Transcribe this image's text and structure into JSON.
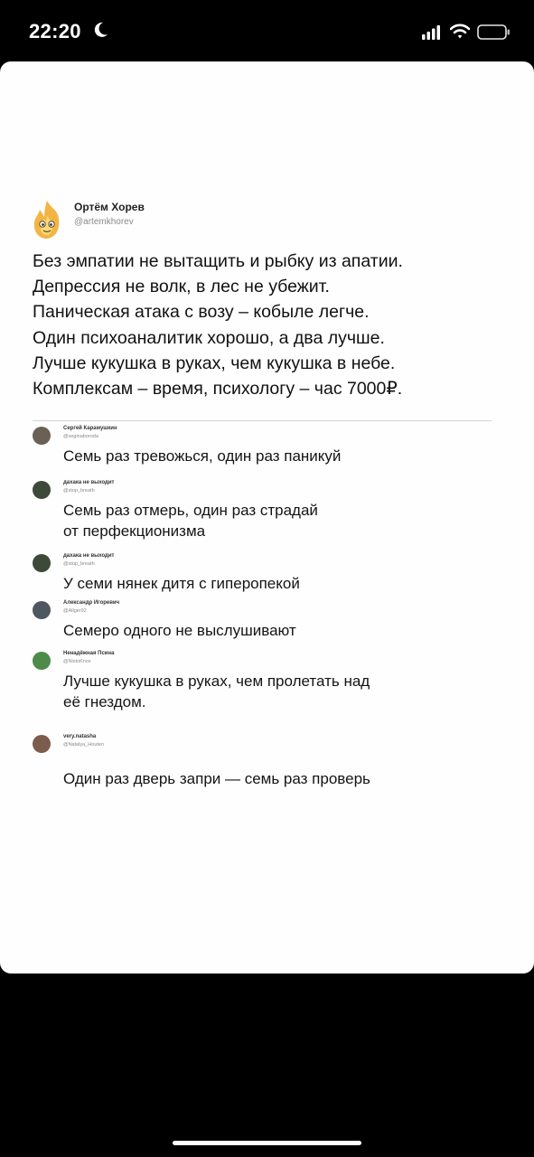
{
  "status_bar": {
    "time": "22:20",
    "moon_icon": "moon-icon",
    "signal_icon": "cellular-signal-icon",
    "wifi_icon": "wifi-icon",
    "battery_icon": "battery-icon"
  },
  "post": {
    "author": {
      "name": "Ортём Хорев",
      "handle": "@artemkhorev",
      "avatar_icon": "flame-avatar-icon"
    },
    "lines": [
      "Без эмпатии не вытащить и рыбку из апатии.",
      "Депрессия не волк, в лес не убежит.",
      "Паническая атака с возу – кобыле легче.",
      "Один психоаналитик хорошо, а два лучше.",
      "Лучше кукушка в руках, чем кукушка в небе.",
      "Комплексам – время, психологу – час 7000₽."
    ]
  },
  "replies": [
    {
      "name": "Сергей Карамушкин",
      "handle": "@seginaborodа",
      "lines": [
        "Семь раз тревожься, один раз паникуй"
      ],
      "avatar_color": "#6b6055"
    },
    {
      "name": "дахака не выходит",
      "handle": "@stop_breath",
      "lines": [
        "Семь раз отмерь, один раз страдай",
        "от перфекционизма"
      ],
      "avatar_color": "#3d4a3a"
    },
    {
      "name": "дахака не выходит",
      "handle": "@stop_breath",
      "lines": [
        "У семи нянек дитя с гиперопекой"
      ],
      "avatar_color": "#3d4a3a"
    },
    {
      "name": "Александр Игоревич",
      "handle": "@Allger92",
      "lines": [
        "Семеро одного не выслушивают"
      ],
      "avatar_color": "#4e5660"
    },
    {
      "name": "Ненадёжная Псина",
      "handle": "@NistoKnox",
      "lines": [
        "Лучше кукушка в руках, чем пролетать над",
        "её гнездом."
      ],
      "avatar_color": "#4e8a4a"
    },
    {
      "name": "very.natasha",
      "handle": "@Natalya_Houten",
      "lines": [
        "Один раз дверь запри — семь раз проверь"
      ],
      "avatar_color": "#7a5d4d"
    }
  ]
}
